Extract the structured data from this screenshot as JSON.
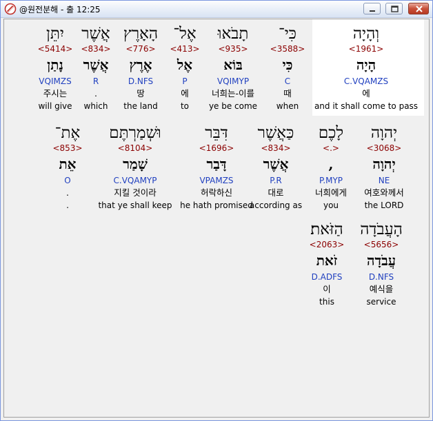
{
  "window": {
    "title": "@원전분해 - 출 12:25"
  },
  "rows": [
    {
      "words": [
        {
          "hebrew": "וְהָיָה",
          "strong": "<1961>",
          "lemma": "הָיָה",
          "morph": "C.VQAMZS",
          "korean": "에",
          "english": "and it shall come to pass",
          "highlight": true
        },
        {
          "hebrew": "כִּי־",
          "strong": "<3588>",
          "lemma": "כִּי",
          "morph": "C",
          "korean": "때",
          "english": "when"
        },
        {
          "hebrew": "תָבֹאוּ",
          "strong": "<935>",
          "lemma": "בּוֹא",
          "morph": "VQIMYP",
          "korean": "너희는-이를",
          "english": "ye be come"
        },
        {
          "hebrew": "אֶל־",
          "strong": "<413>",
          "lemma": "אֶל",
          "morph": "P",
          "korean": "에",
          "english": "to"
        },
        {
          "hebrew": "הָאָרֶץ",
          "strong": "<776>",
          "lemma": "אֶרֶץ",
          "morph": "D.NFS",
          "korean": "땅",
          "english": "the land"
        },
        {
          "hebrew": "אֲשֶׁר",
          "strong": "<834>",
          "lemma": "אֲשֶׁר",
          "morph": "R",
          "korean": ".",
          "english": "which"
        },
        {
          "hebrew": "יִתֵּן",
          "strong": "<5414>",
          "lemma": "נָתַן",
          "morph": "VQIMZS",
          "korean": "주시는",
          "english": "will give"
        }
      ]
    },
    {
      "words": [
        {
          "hebrew": "יְהוָה",
          "strong": "<3068>",
          "lemma": "יְהוָה",
          "morph": "NE",
          "korean": "여호와께서",
          "english": "the LORD"
        },
        {
          "hebrew": "לָכֶם",
          "strong": "<.>",
          "lemma": ",",
          "morph": "P.MYP",
          "korean": "너희에게",
          "english": "you"
        },
        {
          "hebrew": "כַּאֲשֶׁר",
          "strong": "<834>",
          "lemma": "אֲשֶׁר",
          "morph": "P.R",
          "korean": "대로",
          "english": "according as"
        },
        {
          "hebrew": "דִּבֵּר",
          "strong": "<1696>",
          "lemma": "דָּבַר",
          "morph": "VPAMZS",
          "korean": "허락하신",
          "english": "he hath promised"
        },
        {
          "hebrew": "וּשְׁמַרְתֶּם",
          "strong": "<8104>",
          "lemma": "שָׁמַר",
          "morph": "C.VQAMYP",
          "korean": "지킬 것이라",
          "english": "that ye shall keep"
        },
        {
          "hebrew": "אֶת־",
          "strong": "<853>",
          "lemma": "אֵת",
          "morph": "O",
          "korean": ".",
          "english": "."
        }
      ]
    },
    {
      "words": [
        {
          "hebrew": "הָעֲבֹדָה",
          "strong": "<5656>",
          "lemma": "עֲבֹדָה",
          "morph": "D.NFS",
          "korean": "예식을",
          "english": "service"
        },
        {
          "hebrew": "הַזֹּאת׃",
          "strong": "<2063>",
          "lemma": "זֹאת",
          "morph": "D.ADFS",
          "korean": "이",
          "english": "this"
        }
      ]
    }
  ],
  "colors": {
    "strong": "#8b0000",
    "morph": "#1f3fbf",
    "highlight": "#ffffff",
    "background": "#f0f0f0"
  },
  "icons": {
    "app": "scroll-book-icon",
    "minimize": "minimize-icon",
    "maximize": "maximize-icon",
    "close": "close-icon"
  }
}
